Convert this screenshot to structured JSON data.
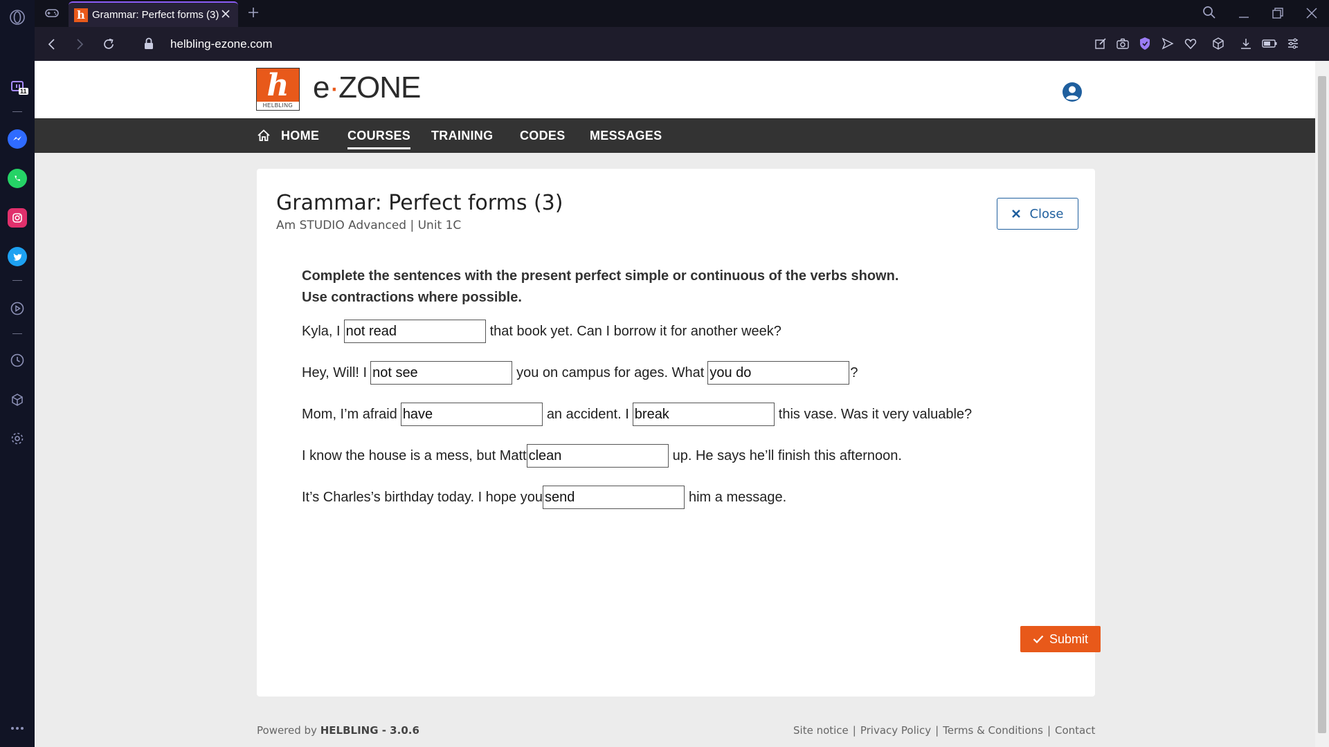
{
  "browser": {
    "tab_title": "Grammar: Perfect forms (3)",
    "favicon_letter": "h",
    "url": "helbling-ezone.com",
    "sidebar_badge": "11",
    "colors": {
      "sidebar": "#111425",
      "tab_accent": "#8b5cf6"
    }
  },
  "site": {
    "logo_letter": "h",
    "logo_caption": "HELBLING",
    "brand_e": "e",
    "brand_zone": "ZONE",
    "nav": [
      {
        "label": "HOME"
      },
      {
        "label": "COURSES",
        "active": true
      },
      {
        "label": "TRAINING"
      },
      {
        "label": "CODES"
      },
      {
        "label": "MESSAGES"
      }
    ],
    "accent": "#e8591a",
    "link_blue": "#1f5f9e"
  },
  "exercise": {
    "title": "Grammar: Perfect forms (3)",
    "subtitle": "Am STUDIO Advanced | Unit 1C",
    "close_label": "Close",
    "instruction": "Complete the sentences with the present perfect simple or continuous of the verbs shown. Use contractions where possible.",
    "sentences": [
      {
        "parts": [
          "Kyla, I",
          "that book yet. Can I borrow it for another week?"
        ],
        "answers": [
          "not read"
        ]
      },
      {
        "parts": [
          "Hey, Will! I",
          "you on campus for ages. What",
          "?"
        ],
        "answers": [
          "not see",
          "you do"
        ]
      },
      {
        "parts": [
          "Mom, I’m afraid",
          "an accident. I",
          "this vase. Was it very valuable?"
        ],
        "answers": [
          "have",
          "break"
        ]
      },
      {
        "parts": [
          "I know the house is a mess, but Matt",
          "up. He says he’ll finish this afternoon."
        ],
        "answers": [
          "clean"
        ]
      },
      {
        "parts": [
          "It’s Charles’s birthday today. I hope you",
          "him a message."
        ],
        "answers": [
          "send"
        ]
      }
    ],
    "submit_label": "Submit"
  },
  "footer": {
    "powered_prefix": "Powered by ",
    "powered_brand": "HELBLING - 3.0.6",
    "links": [
      "Site notice",
      "Privacy Policy",
      "Terms & Conditions",
      "Contact"
    ]
  }
}
